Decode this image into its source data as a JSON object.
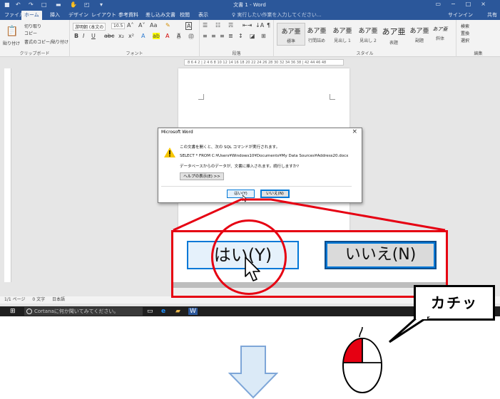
{
  "window": {
    "doc_title": "文書 1 - Word",
    "tabs": [
      "ファイル",
      "ホーム",
      "挿入",
      "デザイン",
      "レイアウト",
      "参考資料",
      "差し込み文書",
      "校閲",
      "表示"
    ],
    "active_tab": "ホーム",
    "tell_me": "♀ 実行したい作業を入力してください...",
    "signin": "サインイン",
    "share": "共有"
  },
  "ribbon": {
    "clipboard": {
      "label": "クリップボード",
      "paste": "貼り付け",
      "cut": "切り取り",
      "copy": "コピー",
      "format_painter": "書式のコピー/貼り付け"
    },
    "font": {
      "label": "フォント",
      "font_name": "游明朝 (本文の",
      "font_size": "10.5"
    },
    "paragraph": {
      "label": "段落"
    },
    "styles": {
      "label": "スタイル",
      "items": [
        {
          "sample": "あア亜",
          "name": "標準"
        },
        {
          "sample": "あア亜",
          "name": "行間詰め"
        },
        {
          "sample": "あア亜",
          "name": "見出し 1"
        },
        {
          "sample": "あア亜",
          "name": "見出し 2"
        },
        {
          "sample": "あア亜",
          "name": "表題"
        },
        {
          "sample": "あア亜",
          "name": "副題"
        },
        {
          "sample": "あア亜",
          "name": "斜体"
        }
      ]
    },
    "editing": {
      "label": "編集",
      "find": "検索",
      "replace": "置換",
      "select": "選択"
    }
  },
  "ruler": "8 6 4 2 | 2 4 6 8 10 12 14 16 18 20 22 24 26 28 30 32 34 36 38 | 42 44 46 48",
  "status": {
    "page": "1/1 ページ",
    "words": "0 文字",
    "language": "日本語"
  },
  "taskbar": {
    "cortana": "Cortanaに何か聞いてみてください。"
  },
  "dialog": {
    "title": "Microsoft Word",
    "line1": "この文書を開くと、次の SQL コマンドが実行されます。",
    "line2": "SELECT * FROM C:¥Users¥Windows10¥Documents¥My Data Sources¥Address20.docx",
    "line3": "データベースからのデータが、文書に挿入されます。続行しますか?",
    "help_button": "ヘルプの表示(E) >>",
    "yes_button": "はい(Y)",
    "no_button": "いいえ(N)"
  },
  "zoom": {
    "yes_button": "はい(Y)",
    "no_button": "いいえ(N)"
  },
  "callout": {
    "text": "カチッ"
  },
  "colors": {
    "accent": "#2b579a",
    "highlight": "#e60012",
    "button_border": "#0078d7"
  }
}
